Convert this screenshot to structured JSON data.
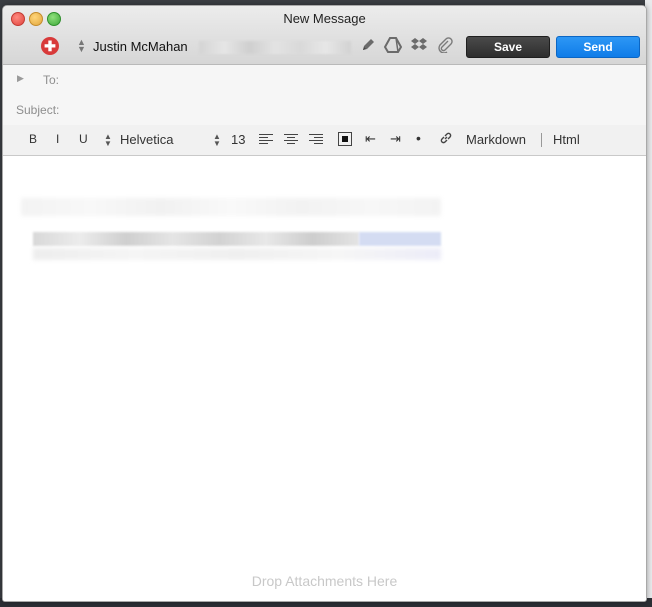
{
  "window": {
    "title": "New Message"
  },
  "header": {
    "from_name": "Justin McMahan",
    "save_label": "Save",
    "send_label": "Send",
    "icons": [
      "from-account-icon",
      "pencil-icon",
      "google-drive-icon",
      "dropbox-icon",
      "paperclip-icon"
    ]
  },
  "fields": {
    "to_label": "To:",
    "subject_label": "Subject:"
  },
  "format_bar": {
    "bold": "B",
    "italic": "I",
    "underline": "U",
    "font": "Helvetica",
    "size": "13",
    "markdown": "Markdown",
    "html": "Html"
  },
  "body": {
    "drop_hint": "Drop Attachments Here"
  },
  "colors": {
    "send_button": "#1485ee",
    "save_button": "#3a3a3a",
    "account_icon": "#d83a3a"
  }
}
